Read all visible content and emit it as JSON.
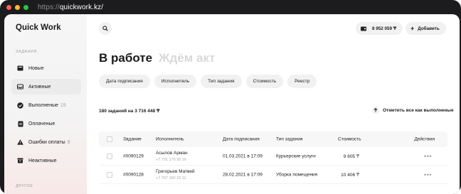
{
  "browser": {
    "url_prefix": "https://",
    "url_domain": "quickwork.kz/"
  },
  "sidebar": {
    "logo": "Quick Work",
    "section_tasks": "ЗАДАНИЯ",
    "section_other": "ДРУГОЕ",
    "items": [
      {
        "label": "Новые",
        "count": "",
        "icon": "inbox-icon"
      },
      {
        "label": "Активные",
        "count": "",
        "icon": "tray-icon"
      },
      {
        "label": "Выполненые",
        "count": "19",
        "icon": "check-circle-icon"
      },
      {
        "label": "Оплаченые",
        "count": "",
        "icon": "document-icon"
      },
      {
        "label": "Ошибки оплаты",
        "count": "8",
        "icon": "warning-icon"
      },
      {
        "label": "Неактивные",
        "count": "",
        "icon": "archive-icon"
      }
    ]
  },
  "header": {
    "balance": "8 952 059 ₸",
    "add_label": "Добавить"
  },
  "tabs": [
    {
      "label": "В работе",
      "active": true
    },
    {
      "label": "Ждём акт",
      "active": false
    }
  ],
  "filters": [
    "Дата подписания",
    "Исполнитель",
    "Тип задания",
    "Стоимость",
    "Реестр"
  ],
  "summary": "180 заданий на 3 716 448 ₸",
  "mark_all_label": "Отметить все как выполненые",
  "table": {
    "columns": {
      "task": "Задание",
      "executor": "Исполнитель",
      "date": "Дата подписания",
      "type": "Тип задания",
      "cost": "Стоимость",
      "actions": "Действия"
    },
    "rows": [
      {
        "task": "#0090129",
        "executor": "Асылов Арман",
        "phone": "+7 701 176 26 16",
        "date": "01.03.2021 в 17:09",
        "type": "Курьерские услуги",
        "cost": "9 605 ₸"
      },
      {
        "task": "#0090128",
        "executor": "Григорьев Матвей",
        "phone": "+7 707 160 22 11",
        "date": "28.02.2021 в 17:09",
        "type": "Уборка помещения",
        "cost": "10 406 ₸"
      }
    ]
  },
  "colors": {
    "frame": "#1c1c1e",
    "sidebar_bg": "#f6f6f6",
    "chip_bg": "#f1f1f1",
    "inactive_tab": "#d9d9d9"
  }
}
